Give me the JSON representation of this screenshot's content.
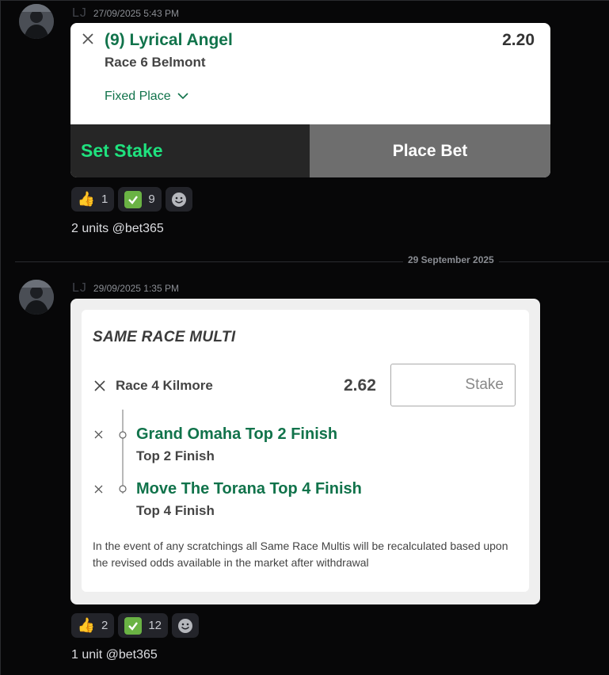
{
  "message1": {
    "author": "LJ",
    "timestamp": "27/09/2025 5:43 PM",
    "bet_card": {
      "selection": "(9) Lyrical Angel",
      "odds": "2.20",
      "race": "Race 6 Belmont",
      "bet_type": "Fixed Place",
      "set_stake_label": "Set Stake",
      "place_bet_label": "Place Bet"
    },
    "reactions": [
      {
        "emoji": "👍",
        "count": "1"
      },
      {
        "emoji": "✅",
        "count": "9"
      }
    ],
    "text": "2 units @bet365"
  },
  "date_divider": "29 September 2025",
  "message2": {
    "author": "LJ",
    "timestamp": "29/09/2025 1:35 PM",
    "multi_card": {
      "title": "SAME RACE MULTI",
      "race": "Race 4 Kilmore",
      "odds": "2.62",
      "stake_placeholder": "Stake",
      "legs": [
        {
          "title": "Grand Omaha Top 2 Finish",
          "subtitle": "Top 2 Finish"
        },
        {
          "title": "Move The Torana Top 4 Finish",
          "subtitle": "Top 4 Finish"
        }
      ],
      "note": "In the event of any scratchings all Same Race Multis will be recalculated based upon the revised odds available in the market after withdrawal"
    },
    "reactions": [
      {
        "emoji": "👍",
        "count": "2"
      },
      {
        "emoji": "✅",
        "count": "12"
      }
    ],
    "text": "1 unit @bet365"
  },
  "colors": {
    "background": "#070708",
    "green_text": "#11734b",
    "set_stake_green": "#1fe27e",
    "check_green": "#6ab344"
  },
  "icons": [
    "close-icon",
    "chevron-down-icon",
    "thumbs-up-icon",
    "check-icon",
    "add-reaction-icon"
  ]
}
